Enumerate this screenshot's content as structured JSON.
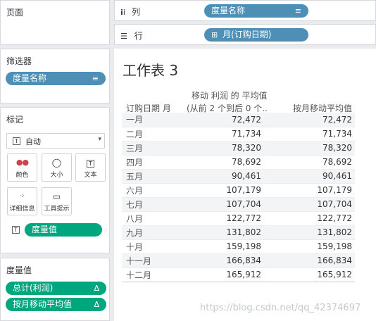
{
  "pages_panel": {
    "title": "页面"
  },
  "columns_shelf": {
    "label": "列",
    "pill": "度量名称"
  },
  "rows_shelf": {
    "label": "行",
    "pill": "月(订购日期)",
    "pill_prefix": "⊞"
  },
  "filters_panel": {
    "title": "筛选器",
    "pill": "度量名称"
  },
  "marks_panel": {
    "title": "标记",
    "mark_type": "自动",
    "cards": [
      {
        "label": "颜色"
      },
      {
        "label": "大小"
      },
      {
        "label": "文本"
      },
      {
        "label": "详细信息"
      },
      {
        "label": "工具提示"
      }
    ],
    "measure_pill": "度量值"
  },
  "measure_values_panel": {
    "title": "度量值",
    "pills": [
      {
        "label": "总计(利润)",
        "trail": "Δ"
      },
      {
        "label": "按月移动平均值",
        "trail": "Δ"
      }
    ]
  },
  "worksheet": {
    "title": "工作表 3",
    "col_header_month": "订购日期 月",
    "col_header_1_line1": "移动 利润 的 平均值",
    "col_header_1_line2": "(从前 2 个到后 0 个..",
    "col_header_2": "按月移动平均值",
    "rows": [
      {
        "month": "一月",
        "v1": "72,472",
        "v2": "72,472"
      },
      {
        "month": "二月",
        "v1": "71,734",
        "v2": "71,734"
      },
      {
        "month": "三月",
        "v1": "78,320",
        "v2": "78,320"
      },
      {
        "month": "四月",
        "v1": "78,692",
        "v2": "78,692"
      },
      {
        "month": "五月",
        "v1": "90,461",
        "v2": "90,461"
      },
      {
        "month": "六月",
        "v1": "107,179",
        "v2": "107,179"
      },
      {
        "month": "七月",
        "v1": "107,704",
        "v2": "107,704"
      },
      {
        "month": "八月",
        "v1": "122,772",
        "v2": "122,772"
      },
      {
        "month": "九月",
        "v1": "131,802",
        "v2": "131,802"
      },
      {
        "month": "十月",
        "v1": "159,198",
        "v2": "159,198"
      },
      {
        "month": "十一月",
        "v1": "166,834",
        "v2": "166,834"
      },
      {
        "month": "十二月",
        "v1": "165,912",
        "v2": "165,912"
      }
    ]
  },
  "watermark": "https://blog.csdn.net/qq_42374697",
  "colors": {
    "blue_pill": "#4e8fb5",
    "green_pill": "#00a67e"
  }
}
